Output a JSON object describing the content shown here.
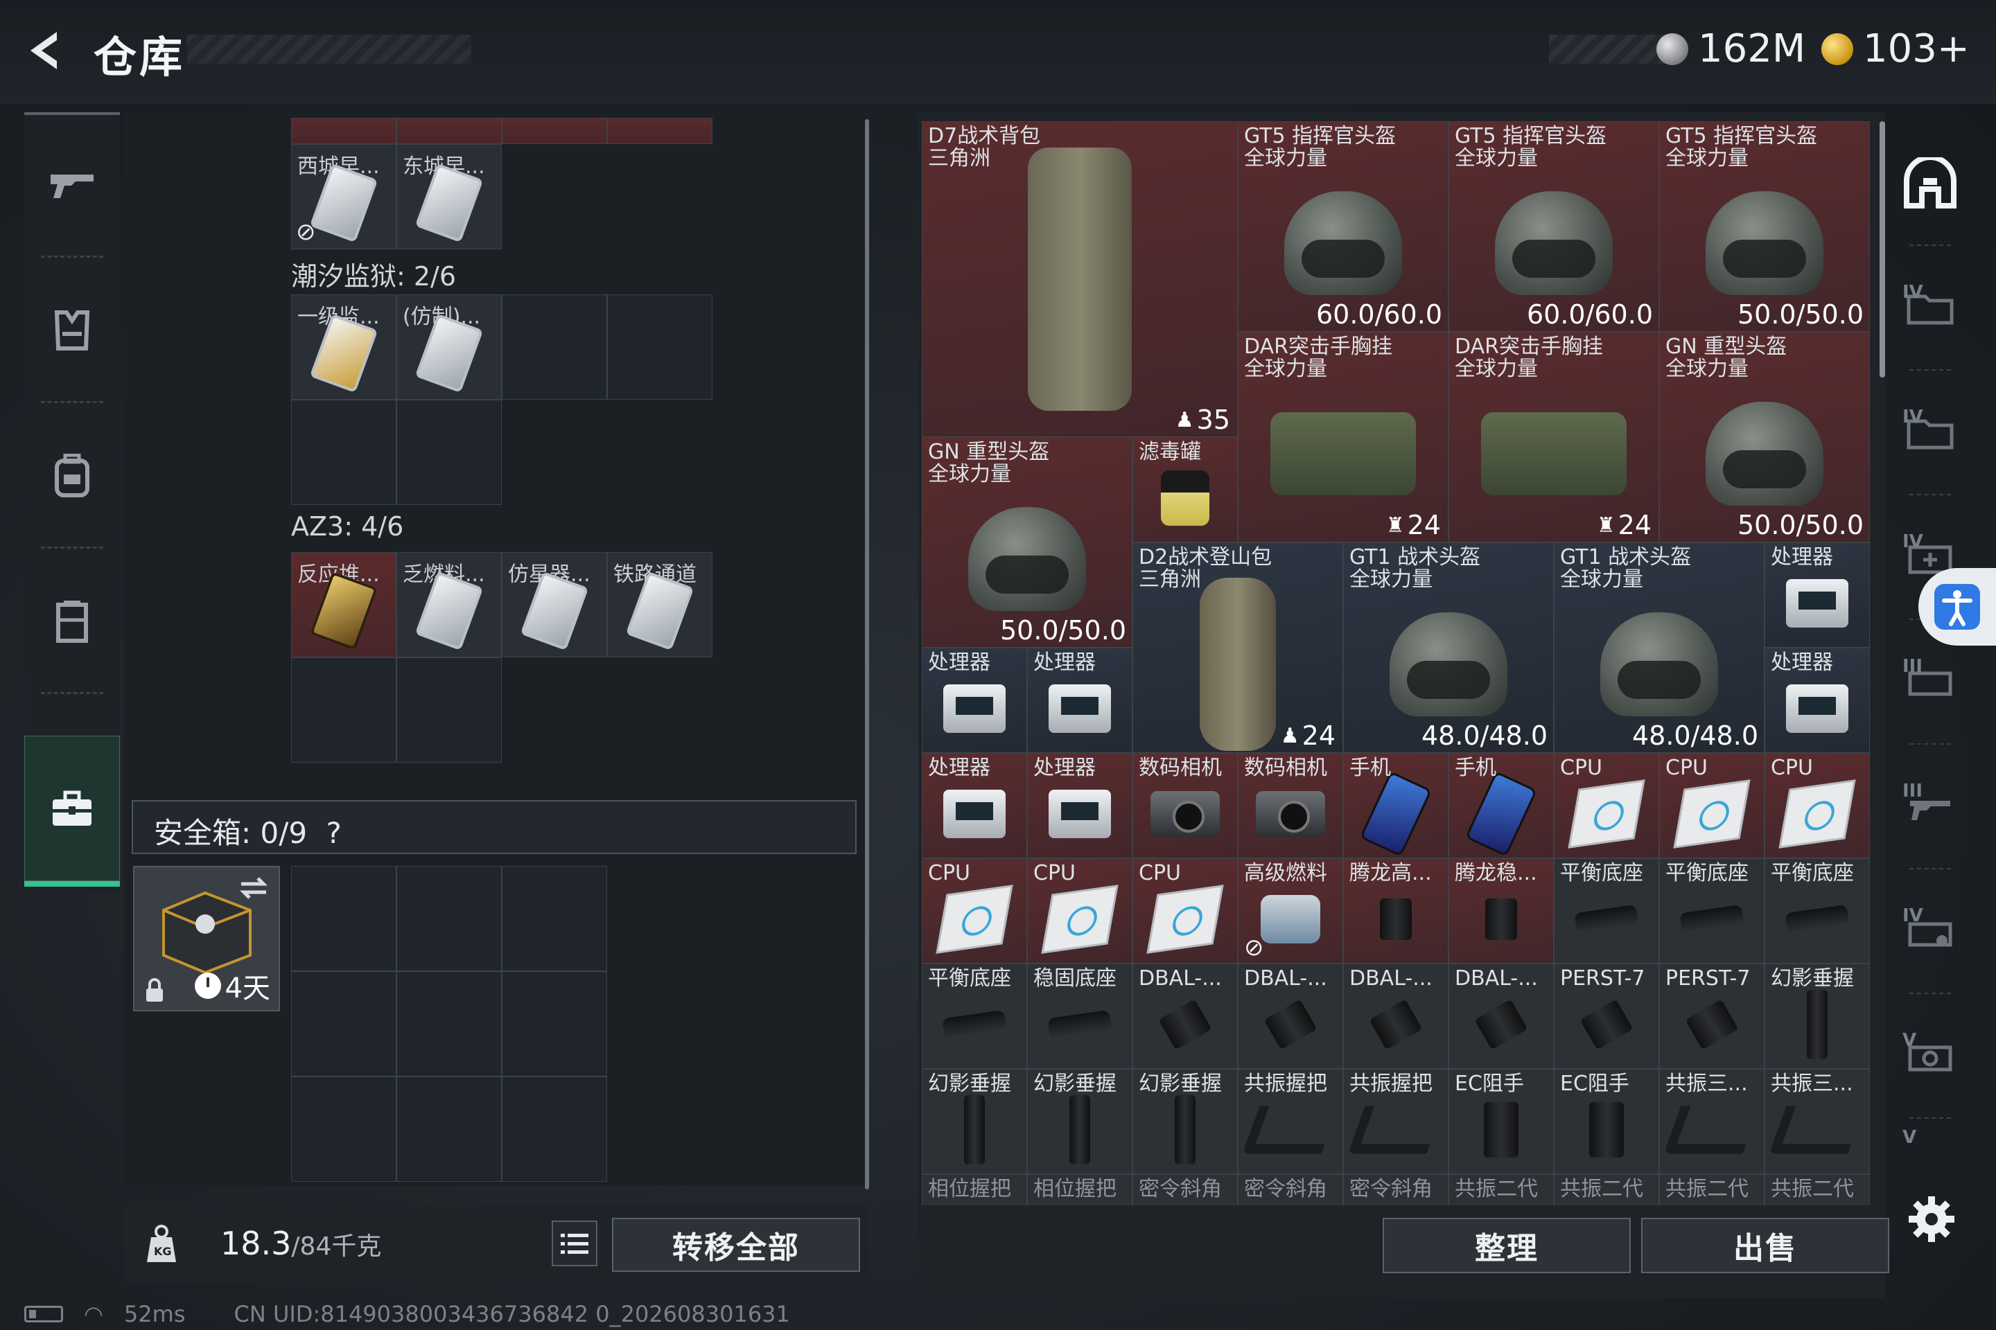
{
  "header": {
    "title": "仓库",
    "currency_silver": "162M",
    "currency_gold": "103+"
  },
  "leftnav": {
    "items": [
      "weapons",
      "armor",
      "backpack",
      "rig",
      "case"
    ]
  },
  "stash_left": {
    "top_row_labels": [
      "西城早...",
      "东城早..."
    ],
    "section1": {
      "label": "潮汐监狱: 2/6",
      "items": [
        "一级监...",
        "(仿制)..."
      ]
    },
    "section2": {
      "label": "AZ3: 4/6",
      "items": [
        "反应堆...",
        "乏燃料...",
        "仿星器...",
        "铁路通道"
      ]
    },
    "safebox": {
      "label": "安全箱: 0/9",
      "help": "?"
    },
    "safe_item_duration": "4天"
  },
  "footer": {
    "weight_value": "18.3",
    "weight_max": "/84千克",
    "transfer_all": "转移全部",
    "arrange": "整理",
    "sell": "出售"
  },
  "status": {
    "ping": "52ms",
    "uid": "CN UID:8149038003436736842 0_202608301631"
  },
  "items": {
    "d7": {
      "l1": "D7战术背包",
      "l2": "三角洲",
      "cnt": "35"
    },
    "gt5a": {
      "l1": "GT5 指挥官头盔",
      "l2": "全球力量",
      "val": "60.0/60.0"
    },
    "gt5b": {
      "l1": "GT5 指挥官头盔",
      "l2": "全球力量",
      "val": "60.0/60.0"
    },
    "gt5c": {
      "l1": "GT5 指挥官头盔",
      "l2": "全球力量",
      "val": "50.0/50.0"
    },
    "dar1": {
      "l1": "DAR突击手胸挂",
      "l2": "全球力量",
      "cnt": "24"
    },
    "dar2": {
      "l1": "DAR突击手胸挂",
      "l2": "全球力量",
      "cnt": "24"
    },
    "gn1": {
      "l1": "GN 重型头盔",
      "l2": "全球力量",
      "val": "50.0/50.0"
    },
    "gn2": {
      "l1": "GN 重型头盔",
      "l2": "全球力量",
      "val": "50.0/50.0"
    },
    "filter": {
      "l1": "滤毒罐"
    },
    "d2": {
      "l1": "D2战术登山包",
      "l2": "三角洲",
      "cnt": "24"
    },
    "gt1a": {
      "l1": "GT1 战术头盔",
      "l2": "全球力量",
      "val": "48.0/48.0"
    },
    "gt1b": {
      "l1": "GT1 战术头盔",
      "l2": "全球力量",
      "val": "48.0/48.0"
    },
    "processor": "处理器",
    "camera": "数码相机",
    "phone": "手机",
    "cpu": "CPU",
    "fuel": "高级燃料",
    "tenglong_hi": "腾龙高...",
    "tenglong_st": "腾龙稳...",
    "balance_mount": "平衡底座",
    "stable_mount": "稳固底座",
    "dbal": "DBAL-...",
    "perst": "PERST-7",
    "phantom_grip": "幻影垂握",
    "resonance_grip": "共振握把",
    "ec": "EC阻手",
    "resonance3": "共振三...",
    "phase_grip": "相位握把",
    "secret_angle": "密令斜角",
    "resonance_gen2": "共振二代"
  },
  "sidetabs": [
    "IV",
    "IV",
    "IV",
    "III",
    "III",
    "IV",
    "V",
    "V"
  ]
}
